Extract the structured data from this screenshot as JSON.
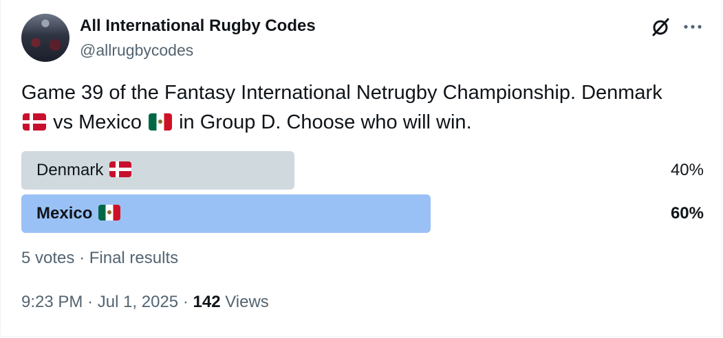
{
  "author": {
    "name": "All International Rugby Codes",
    "handle": "@allrugbycodes"
  },
  "tweet": {
    "text_part1": "Game 39 of the Fantasy International Netrugby Championship. Denmark",
    "text_part2": "vs Mexico",
    "text_part3": "in Group D. Choose who will win."
  },
  "poll": {
    "options": [
      {
        "label": "Denmark",
        "flag": "denmark-flag",
        "percent_label": "40%",
        "share": 0.4,
        "bar_color": "#cfd9de",
        "winner": false
      },
      {
        "label": "Mexico",
        "flag": "mexico-flag",
        "percent_label": "60%",
        "share": 0.6,
        "bar_color": "#9ac1f5",
        "winner": true
      }
    ],
    "votes": "5 votes",
    "separator": "·",
    "status": "Final results"
  },
  "meta": {
    "time": "9:23 PM",
    "date": "Jul 1, 2025",
    "separator": "·",
    "views_count": "142",
    "views_label": "Views"
  },
  "icons": {
    "grok": "grok-icon",
    "more": "more-icon"
  }
}
